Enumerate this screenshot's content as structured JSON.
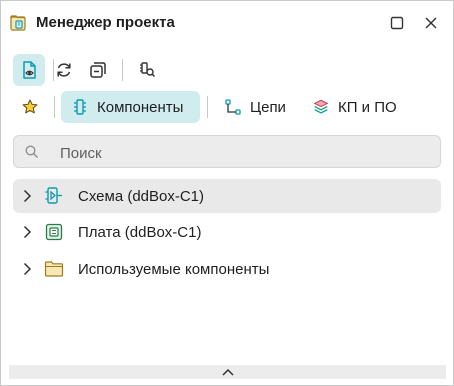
{
  "window": {
    "title": "Менеджер проекта"
  },
  "toolbar": {
    "buttons": [
      {
        "name": "view-mode",
        "icon": "document-eye-icon",
        "active": true
      },
      {
        "name": "refresh",
        "icon": "refresh-icon",
        "active": false
      },
      {
        "name": "collapse-all",
        "icon": "collapse-icon",
        "active": false
      },
      {
        "name": "find-component",
        "icon": "component-search-icon",
        "active": false
      }
    ]
  },
  "tabs": [
    {
      "label": "",
      "icon": "star-icon",
      "active": false
    },
    {
      "label": "Компоненты",
      "icon": "component-icon",
      "active": true
    },
    {
      "label": "Цепи",
      "icon": "net-icon",
      "active": false
    },
    {
      "label": "КП и ПО",
      "icon": "layers-icon",
      "active": false
    }
  ],
  "search": {
    "placeholder": "Поиск",
    "value": ""
  },
  "tree": [
    {
      "label": "Схема (ddBox-C1)",
      "icon": "schematic-icon",
      "selected": true
    },
    {
      "label": "Плата (ddBox-C1)",
      "icon": "board-icon",
      "selected": false
    },
    {
      "label": "Используемые компоненты",
      "icon": "folder-icon",
      "selected": false
    }
  ],
  "colors": {
    "accent": "#0f9ab0",
    "active_bg": "#d0ecef",
    "selected_bg": "#e9e9e9",
    "star": "#f0c419"
  }
}
